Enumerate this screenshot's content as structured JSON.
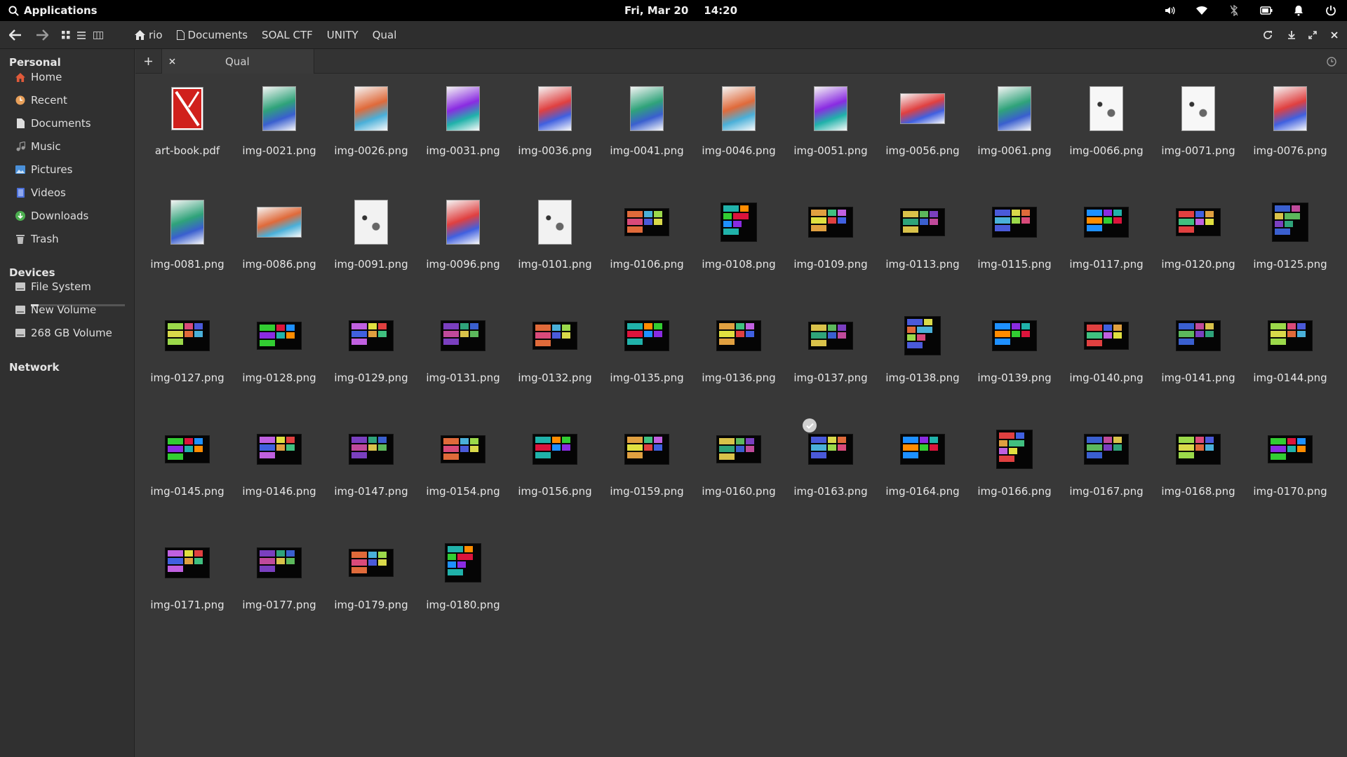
{
  "panel": {
    "applications_label": "Applications",
    "date": "Fri, Mar 20",
    "time": "14:20",
    "indicators": [
      "volume-icon",
      "wifi-icon",
      "bluetooth-icon",
      "battery-icon",
      "notifications-icon",
      "power-icon"
    ]
  },
  "toolbar": {
    "breadcrumbs": [
      {
        "label": "rio",
        "icon": "home-icon"
      },
      {
        "label": "Documents",
        "icon": "document-icon"
      },
      {
        "label": "SOAL CTF"
      },
      {
        "label": "UNITY"
      },
      {
        "label": "Qual"
      }
    ]
  },
  "sidebar": {
    "sections": {
      "personal": "Personal",
      "devices": "Devices",
      "network": "Network"
    },
    "personal_items": [
      {
        "label": "Home",
        "icon": "home-icon",
        "color": "#e05a3a"
      },
      {
        "label": "Recent",
        "icon": "clock-icon",
        "color": "#e8a05a"
      },
      {
        "label": "Documents",
        "icon": "document-icon",
        "color": "#dddddd"
      },
      {
        "label": "Music",
        "icon": "music-icon",
        "color": "#aaaaaa"
      },
      {
        "label": "Pictures",
        "icon": "picture-icon",
        "color": "#4a90d9"
      },
      {
        "label": "Videos",
        "icon": "video-icon",
        "color": "#4a6fd9"
      },
      {
        "label": "Downloads",
        "icon": "download-icon",
        "color": "#4caf50"
      },
      {
        "label": "Trash",
        "icon": "trash-icon",
        "color": "#bbbbbb"
      }
    ],
    "device_items": [
      {
        "label": "File System",
        "icon": "drive-icon",
        "usage": 0.08
      },
      {
        "label": "New Volume",
        "icon": "drive-icon"
      },
      {
        "label": "268 GB Volume",
        "icon": "drive-icon"
      }
    ]
  },
  "tabs": [
    {
      "label": "Qual"
    }
  ],
  "files": [
    "art-book.pdf",
    "img-0021.png",
    "img-0026.png",
    "img-0031.png",
    "img-0036.png",
    "img-0041.png",
    "img-0046.png",
    "img-0051.png",
    "img-0056.png",
    "img-0061.png",
    "img-0066.png",
    "img-0071.png",
    "img-0076.png",
    "img-0081.png",
    "img-0086.png",
    "img-0091.png",
    "img-0096.png",
    "img-0101.png",
    "img-0106.png",
    "img-0108.png",
    "img-0109.png",
    "img-0113.png",
    "img-0115.png",
    "img-0117.png",
    "img-0120.png",
    "img-0125.png",
    "img-0127.png",
    "img-0128.png",
    "img-0129.png",
    "img-0131.png",
    "img-0132.png",
    "img-0135.png",
    "img-0136.png",
    "img-0137.png",
    "img-0138.png",
    "img-0139.png",
    "img-0140.png",
    "img-0141.png",
    "img-0144.png",
    "img-0145.png",
    "img-0146.png",
    "img-0147.png",
    "img-0154.png",
    "img-0156.png",
    "img-0159.png",
    "img-0160.png",
    "img-0163.png",
    "img-0164.png",
    "img-0166.png",
    "img-0167.png",
    "img-0168.png",
    "img-0170.png",
    "img-0171.png",
    "img-0177.png",
    "img-0179.png",
    "img-0180.png"
  ],
  "selected_file": "img-0163.png"
}
